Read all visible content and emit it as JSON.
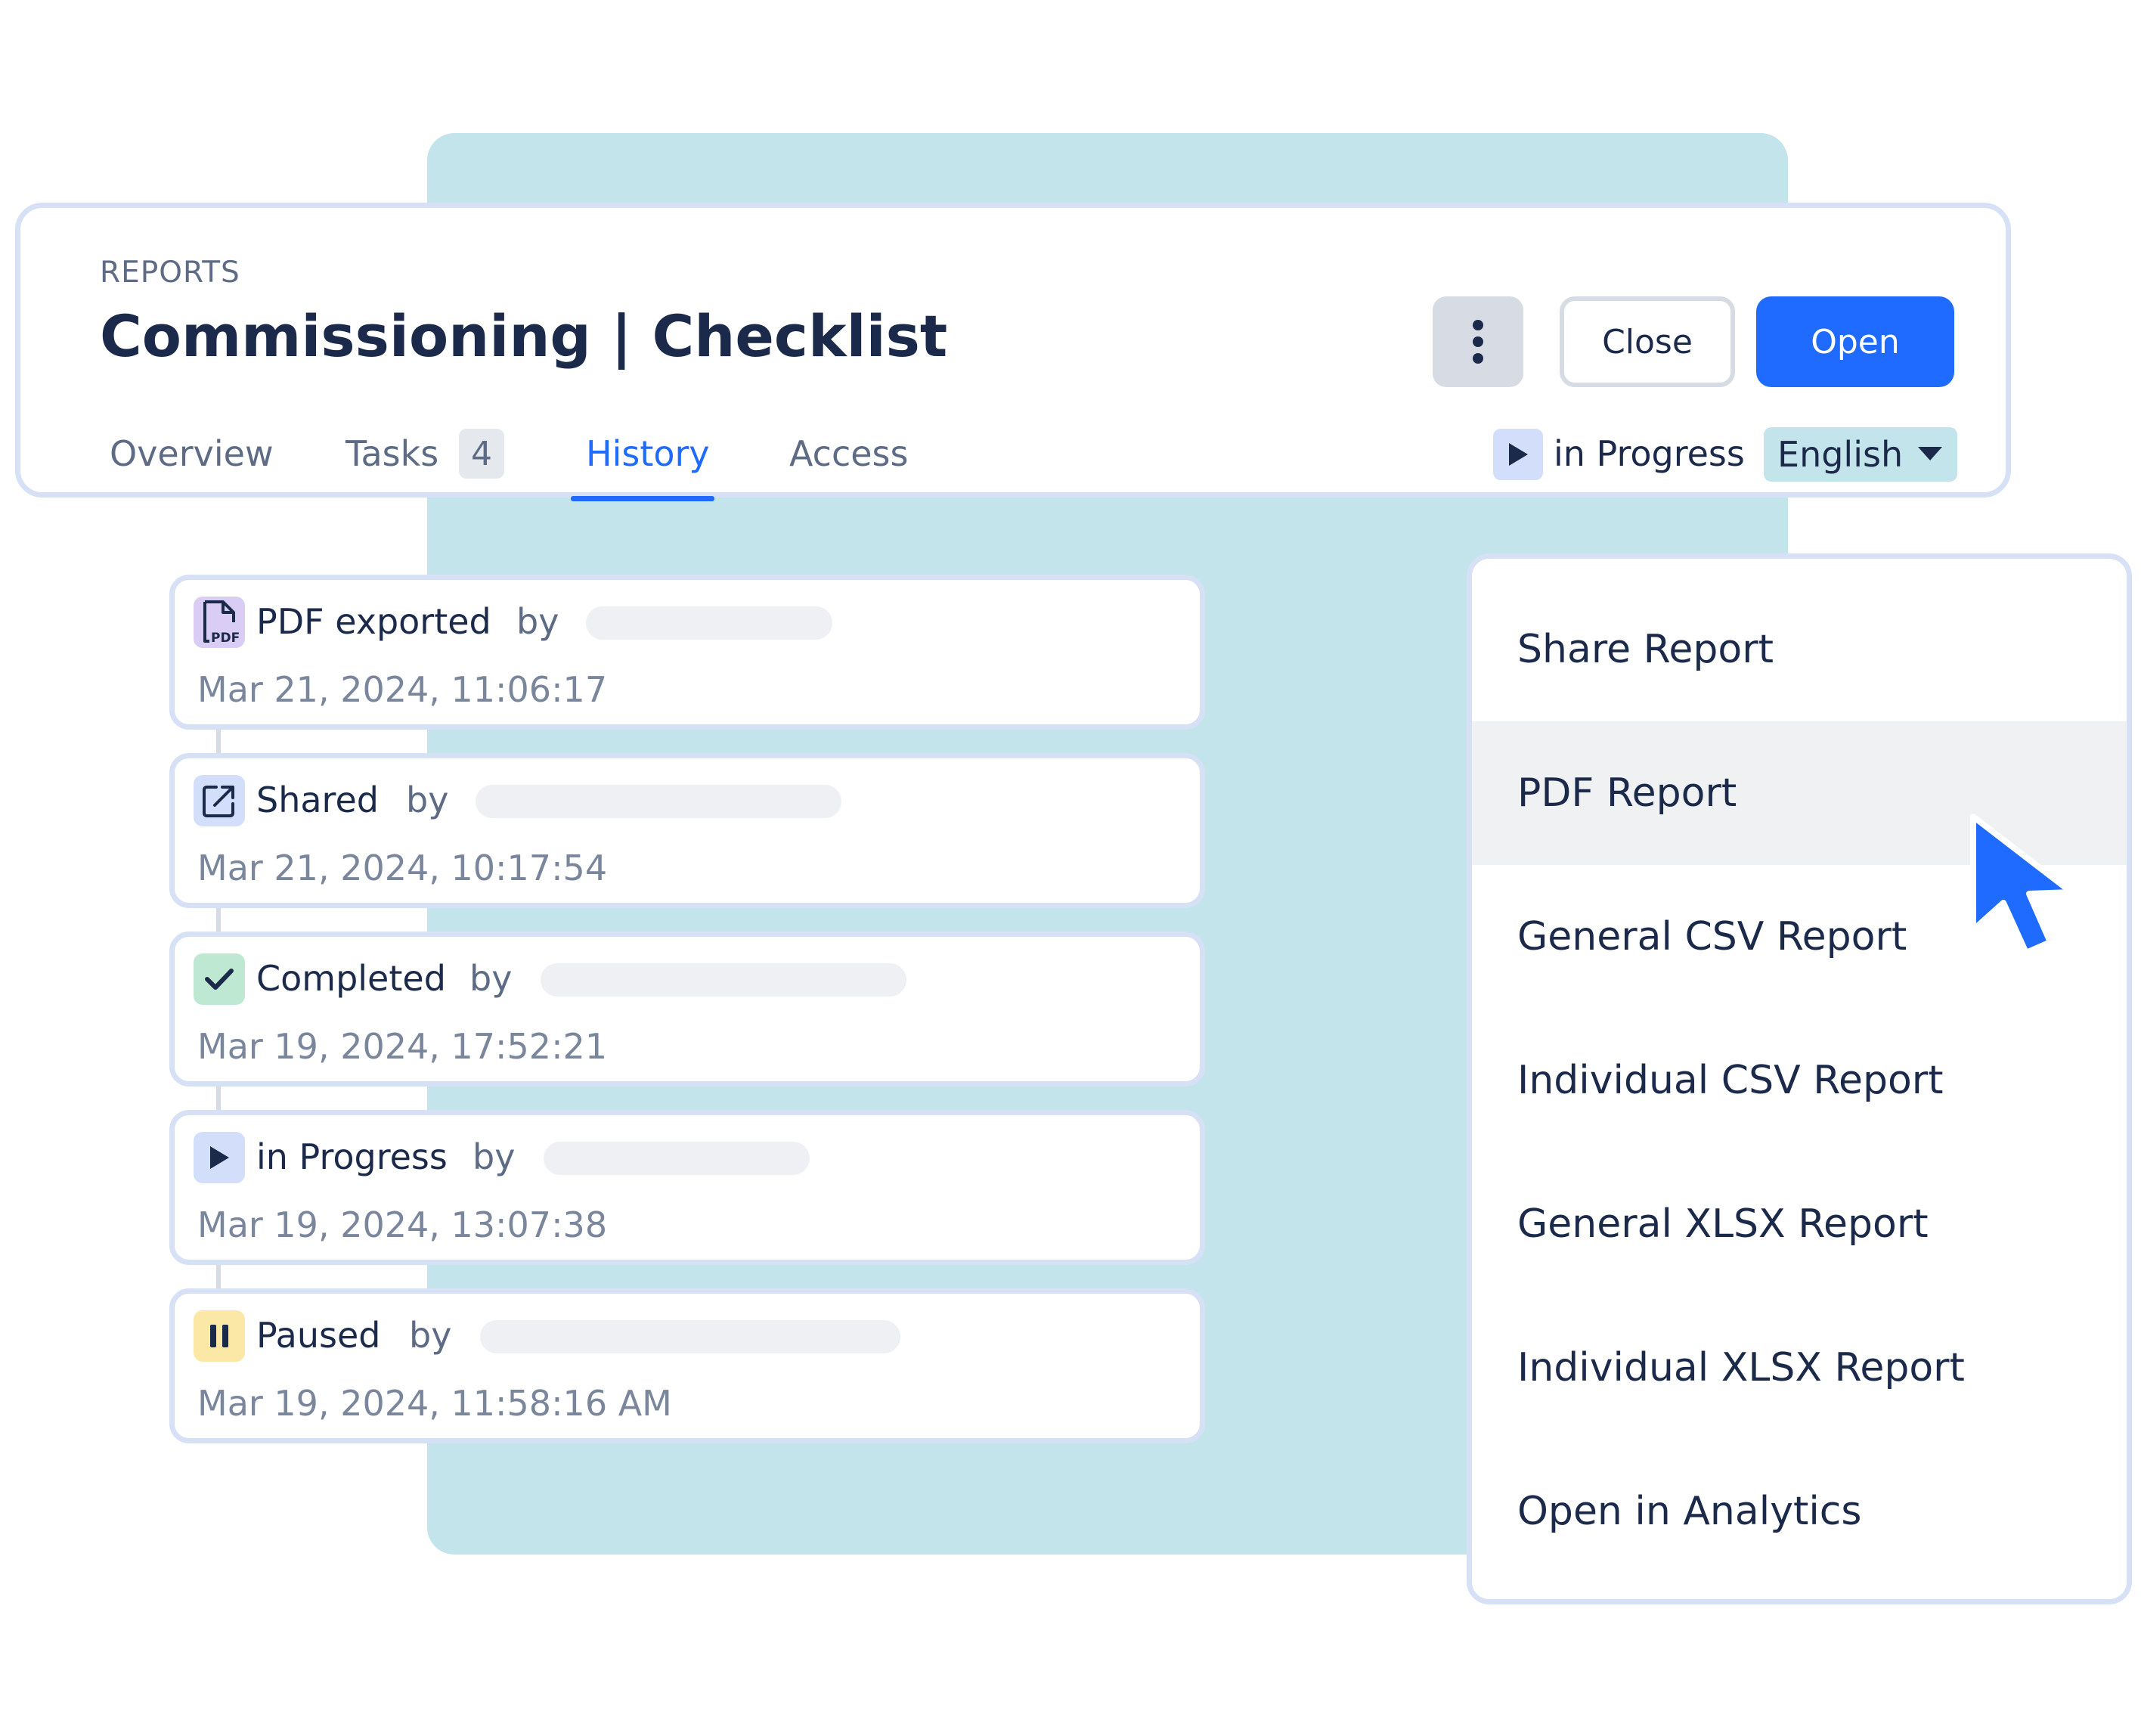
{
  "header": {
    "breadcrumb": "REPORTS",
    "title": "Commissioning | Checklist",
    "close_label": "Close",
    "open_label": "Open"
  },
  "tabs": [
    {
      "label": "Overview"
    },
    {
      "label": "Tasks",
      "badge": "4"
    },
    {
      "label": "History",
      "active": true
    },
    {
      "label": "Access"
    }
  ],
  "status": {
    "label": "in Progress",
    "icon": "play-icon"
  },
  "language": {
    "selected": "English"
  },
  "history": [
    {
      "label": "PDF exported",
      "by": "by",
      "time": "Mar 21, 2024, 11:06:17",
      "icon": "pdf-file-icon"
    },
    {
      "label": "Shared",
      "by": "by",
      "time": "Mar 21, 2024, 10:17:54",
      "icon": "share-icon"
    },
    {
      "label": "Completed",
      "by": "by",
      "time": "Mar 19, 2024, 17:52:21",
      "icon": "check-icon"
    },
    {
      "label": "in Progress",
      "by": "by",
      "time": "Mar 19, 2024, 13:07:38",
      "icon": "play-icon"
    },
    {
      "label": "Paused",
      "by": "by",
      "time": "Mar 19, 2024, 11:58:16 AM",
      "icon": "pause-icon"
    }
  ],
  "menu": {
    "items": [
      {
        "label": "Share Report"
      },
      {
        "label": "PDF Report",
        "hovered": true
      },
      {
        "label": "General CSV Report"
      },
      {
        "label": "Individual CSV Report"
      },
      {
        "label": "General XLSX Report"
      },
      {
        "label": "Individual XLSX Report"
      },
      {
        "label": "Open in Analytics"
      }
    ]
  },
  "colors": {
    "accent": "#1f6bff",
    "backdrop": "#c3e4eb",
    "card_border": "#d6e1f5",
    "pdf_icon_bg": "#d9ccf5",
    "completed_icon_bg": "#bfe8d3",
    "progress_icon_bg": "#d3defa",
    "paused_icon_bg": "#fbe7a6"
  }
}
